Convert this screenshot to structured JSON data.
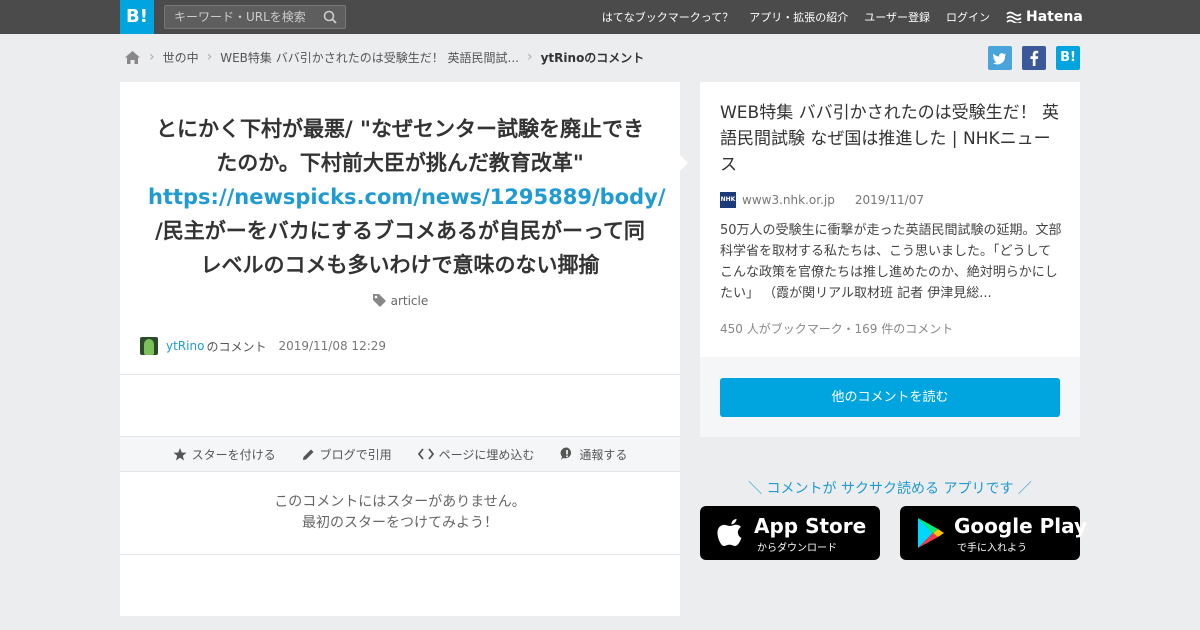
{
  "header": {
    "logo": "B!",
    "search_placeholder": "キーワード・URLを検索",
    "nav": [
      "はてなブックマークって？",
      "アプリ・拡張の紹介",
      "ユーザー登録",
      "ログイン"
    ],
    "brand": "Hatena"
  },
  "breadcrumb": {
    "items": [
      "世の中",
      "WEB特集 ババ引かされたのは受験生だ！ 英語民間試...",
      "ytRinoのコメント"
    ]
  },
  "social": [
    {
      "label": "t",
      "color": "#4aa4dc"
    },
    {
      "label": "f",
      "color": "#3b5998"
    },
    {
      "label": "B!",
      "color": "#00a4de"
    }
  ],
  "comment": {
    "text_before": "とにかく下村が最悪/ \"なぜセンター試験を廃止できたのか。下村前大臣が挑んだ教育改革\" ",
    "link": "https://newspicks.com/news/1295889/body/",
    "text_after": " /民主がーをバカにするブコメあるが自民がーって同レベルのコメも多いわけで意味のない揶揄",
    "tag": "article",
    "user": "ytRino",
    "user_suffix": "のコメント",
    "date": "2019/11/08 12:29"
  },
  "actions": [
    "スターを付ける",
    "ブログで引用",
    "ページに埋め込む",
    "通報する"
  ],
  "stars": {
    "line1": "このコメントにはスターがありません。",
    "line2": "最初のスターをつけてみよう！"
  },
  "entry": {
    "title": "WEB特集 ババ引かされたのは受験生だ！ 英語民間試験 なぜ国は推進した | NHKニュース",
    "site_icon": "NHK",
    "domain": "www3.nhk.or.jp",
    "date": "2019/11/07",
    "summary": "50万人の受験生に衝撃が走った英語民間試験の延期。文部科学省を取材する私たちは、こう思いました。「どうしてこんな政策を官僚たちは推し進めたのか、絶対明らかにしたい」 （霞が関リアル取材班 記者 伊津見総...",
    "count": "450 人がブックマーク・169 件のコメント",
    "read_button": "他のコメントを読む"
  },
  "promo": {
    "text": "＼ コメントが サクサク読める アプリです ／",
    "appstore_big": "App Store",
    "appstore_small": "からダウンロード",
    "googleplay_big": "Google Play",
    "googleplay_small": "で手に入れよう"
  }
}
